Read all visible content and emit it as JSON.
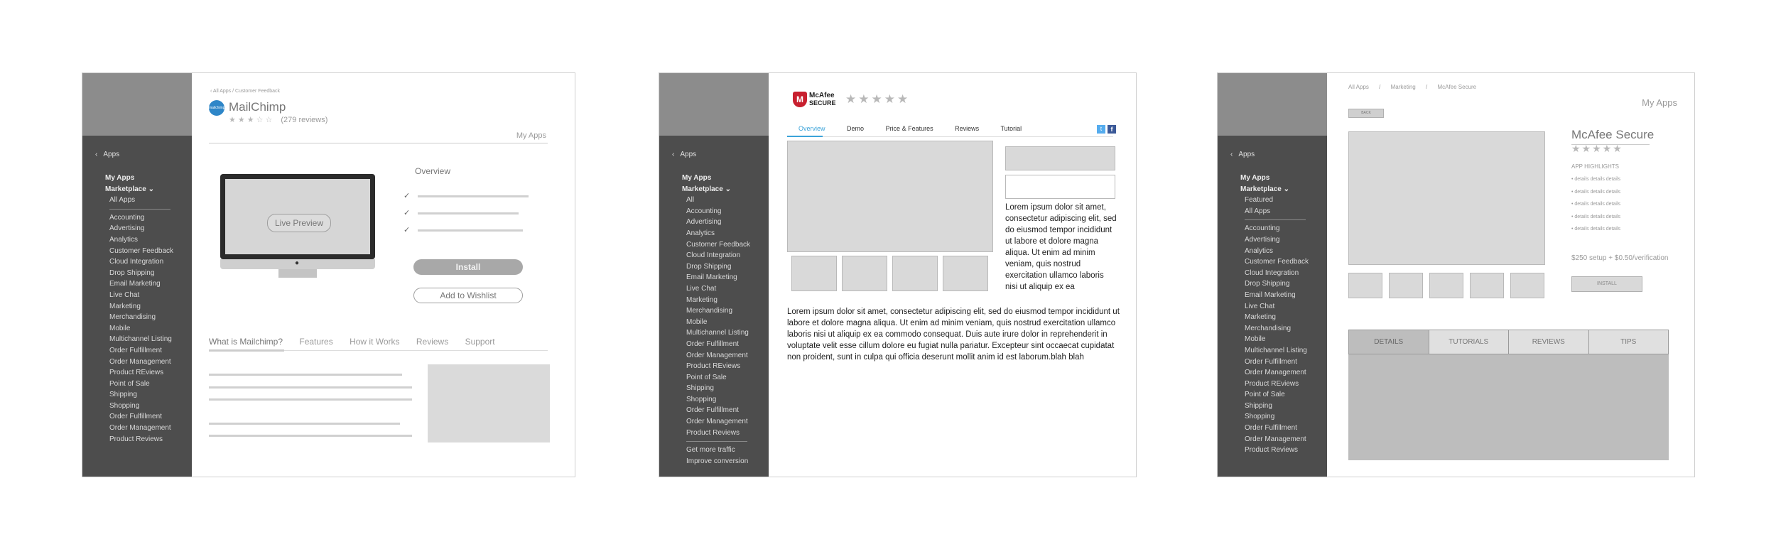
{
  "frame1": {
    "sidebar": {
      "back": "Apps",
      "items": [
        {
          "label": "My Apps",
          "bold": true
        },
        {
          "label": "Marketplace ⌄",
          "bold": true
        },
        {
          "label": "All Apps",
          "sub": true
        },
        {
          "label": "---"
        },
        {
          "label": "Accounting",
          "sub": true
        },
        {
          "label": "Advertising",
          "sub": true
        },
        {
          "label": "Analytics",
          "sub": true
        },
        {
          "label": "Customer Feedback",
          "sub": true
        },
        {
          "label": "Cloud Integration",
          "sub": true
        },
        {
          "label": "Drop Shipping",
          "sub": true
        },
        {
          "label": "Email Marketing",
          "sub": true
        },
        {
          "label": "Live Chat",
          "sub": true
        },
        {
          "label": "Marketing",
          "sub": true
        },
        {
          "label": "Merchandising",
          "sub": true
        },
        {
          "label": "Mobile",
          "sub": true
        },
        {
          "label": "Multichannel Listing",
          "sub": true
        },
        {
          "label": "Order Fulfillment",
          "sub": true
        },
        {
          "label": "Order Management",
          "sub": true
        },
        {
          "label": "Product REviews",
          "sub": true
        },
        {
          "label": "Point of Sale",
          "sub": true
        },
        {
          "label": "Shipping",
          "sub": true
        },
        {
          "label": "Shopping",
          "sub": true
        },
        {
          "label": "Order Fulfillment",
          "sub": true
        },
        {
          "label": "Order Management",
          "sub": true
        },
        {
          "label": "Product Reviews",
          "sub": true
        }
      ]
    },
    "breadcrumb": "All Apps / Customer Feedback",
    "logo_text": "mailchimp",
    "app_name": "MailChimp",
    "reviews": "(279 reviews)",
    "rating": "★★★☆☆",
    "my_apps": "My Apps",
    "live_preview": "Live Preview",
    "overview": "Overview",
    "install": "Install",
    "wishlist": "Add to Wishlist",
    "tabs": [
      "What is Mailchimp?",
      "Features",
      "How it Works",
      "Reviews",
      "Support"
    ]
  },
  "frame2": {
    "sidebar": {
      "back": "Apps",
      "items": [
        {
          "label": "My Apps",
          "bold": true
        },
        {
          "label": "Marketplace ⌄",
          "bold": true
        },
        {
          "label": "All",
          "sub": true
        },
        {
          "label": "Accounting",
          "sub": true
        },
        {
          "label": "Advertising",
          "sub": true
        },
        {
          "label": "Analytics",
          "sub": true
        },
        {
          "label": "Customer Feedback",
          "sub": true
        },
        {
          "label": "Cloud Integration",
          "sub": true
        },
        {
          "label": "Drop Shipping",
          "sub": true
        },
        {
          "label": "Email Marketing",
          "sub": true
        },
        {
          "label": "Live Chat",
          "sub": true
        },
        {
          "label": "Marketing",
          "sub": true
        },
        {
          "label": "Merchandising",
          "sub": true
        },
        {
          "label": "Mobile",
          "sub": true
        },
        {
          "label": "Multichannel Listing",
          "sub": true
        },
        {
          "label": "Order Fulfillment",
          "sub": true
        },
        {
          "label": "Order Management",
          "sub": true
        },
        {
          "label": "Product REviews",
          "sub": true
        },
        {
          "label": "Point of Sale",
          "sub": true
        },
        {
          "label": "Shipping",
          "sub": true
        },
        {
          "label": "Shopping",
          "sub": true
        },
        {
          "label": "Order Fulfillment",
          "sub": true
        },
        {
          "label": "Order Management",
          "sub": true
        },
        {
          "label": "Product Reviews",
          "sub": true
        },
        {
          "label": "---"
        },
        {
          "label": "Get more traffic",
          "sub": true
        },
        {
          "label": "Improve conversion",
          "sub": true
        }
      ]
    },
    "logo_line1": "McAfee",
    "logo_line2": "SECURE",
    "rating": "★★★★★",
    "tabs": [
      "Overview",
      "Demo",
      "Price & Features",
      "Reviews",
      "Tutorial"
    ],
    "side_text": "Lorem ipsum dolor sit amet, consectetur adipiscing elit, sed do eiusmod tempor incididunt ut labore et dolore magna aliqua. Ut enim ad minim veniam, quis nostrud exercitation ullamco laboris nisi ut aliquip ex ea",
    "body_text": "Lorem ipsum dolor sit amet, consectetur adipiscing elit, sed do eiusmod tempor incididunt ut labore et dolore magna aliqua. Ut enim ad minim veniam, quis nostrud exercitation ullamco laboris nisi ut aliquip ex ea commodo consequat. Duis aute irure dolor in reprehenderit in voluptate velit esse cillum dolore eu fugiat nulla pariatur. Excepteur sint occaecat cupidatat non proident, sunt in culpa qui officia deserunt mollit anim id est laborum.blah blah"
  },
  "frame3": {
    "sidebar": {
      "back": "Apps",
      "items": [
        {
          "label": "My Apps",
          "bold": true
        },
        {
          "label": "Marketplace ⌄",
          "bold": true
        },
        {
          "label": "Featured",
          "sub": true
        },
        {
          "label": "All Apps",
          "sub": true
        },
        {
          "label": "---"
        },
        {
          "label": "Accounting",
          "sub": true
        },
        {
          "label": "Advertising",
          "sub": true
        },
        {
          "label": "Analytics",
          "sub": true
        },
        {
          "label": "Customer Feedback",
          "sub": true
        },
        {
          "label": "Cloud Integration",
          "sub": true
        },
        {
          "label": "Drop Shipping",
          "sub": true
        },
        {
          "label": "Email Marketing",
          "sub": true
        },
        {
          "label": "Live Chat",
          "sub": true
        },
        {
          "label": "Marketing",
          "sub": true
        },
        {
          "label": "Merchandising",
          "sub": true
        },
        {
          "label": "Mobile",
          "sub": true
        },
        {
          "label": "Multichannel Listing",
          "sub": true
        },
        {
          "label": "Order Fulfillment",
          "sub": true
        },
        {
          "label": "Order Management",
          "sub": true
        },
        {
          "label": "Product REviews",
          "sub": true
        },
        {
          "label": "Point of Sale",
          "sub": true
        },
        {
          "label": "Shipping",
          "sub": true
        },
        {
          "label": "Shopping",
          "sub": true
        },
        {
          "label": "Order Fulfillment",
          "sub": true
        },
        {
          "label": "Order Management",
          "sub": true
        },
        {
          "label": "Product Reviews",
          "sub": true
        }
      ]
    },
    "breadcrumb": [
      "All Apps",
      "/",
      "Marketing",
      "/",
      "McAfee Secure"
    ],
    "my_apps": "My Apps",
    "back_btn": "BACK",
    "app_name": "McAfee Secure",
    "rating": "★★★★★",
    "highlights_title": "APP HIGHLIGHTS",
    "highlights": [
      "details details details",
      "details details details",
      "details details details",
      "details details details",
      "details details details"
    ],
    "price": "$250 setup + $0.50/verification",
    "install": "INSTALL",
    "tabs": [
      "DETAILS",
      "TUTORIALS",
      "REVIEWS",
      "TIPS"
    ]
  }
}
